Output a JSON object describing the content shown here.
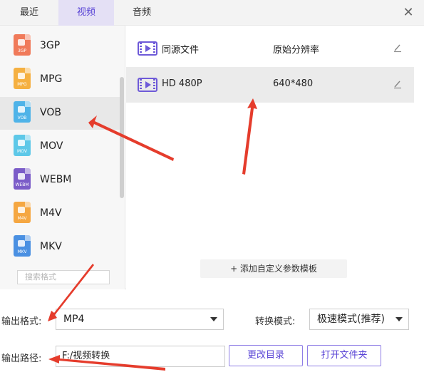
{
  "tabs": [
    {
      "label": "最近"
    },
    {
      "label": "视频"
    },
    {
      "label": "音频"
    }
  ],
  "close_icon": "close-icon",
  "formats": [
    {
      "label": "3GP",
      "icon_text": "3GP",
      "color": "#f07a5a",
      "selected": false
    },
    {
      "label": "MPG",
      "icon_text": "MPG",
      "color": "#f5b041",
      "selected": false
    },
    {
      "label": "VOB",
      "icon_text": "VOB",
      "color": "#4fb3e8",
      "selected": true
    },
    {
      "label": "MOV",
      "icon_text": "MOV",
      "color": "#5ec8e8",
      "selected": false
    },
    {
      "label": "WEBM",
      "icon_text": "WEBM",
      "color": "#7b5cc8",
      "selected": false
    },
    {
      "label": "M4V",
      "icon_text": "M4V",
      "color": "#f5a742",
      "selected": false
    },
    {
      "label": "MKV",
      "icon_text": "MKV",
      "color": "#4a90e2",
      "selected": false
    }
  ],
  "search": {
    "placeholder": "搜索格式"
  },
  "presets": [
    {
      "name": "同源文件",
      "resolution": "原始分辨率",
      "selected": false
    },
    {
      "name": "HD 480P",
      "resolution": "640*480",
      "selected": true
    }
  ],
  "add_preset_label": "+ 添加自定义参数模板",
  "output_format": {
    "label": "输出格式:",
    "value": "MP4"
  },
  "convert_mode": {
    "label": "转换模式:",
    "value": "极速模式(推荐)"
  },
  "output_path": {
    "label": "输出路径:",
    "value": "F:/视频转换"
  },
  "buttons": {
    "change_dir": "更改目录",
    "open_folder": "打开文件夹"
  },
  "colors": {
    "accent": "#5a45d6",
    "arrow": "#e53c2c"
  }
}
